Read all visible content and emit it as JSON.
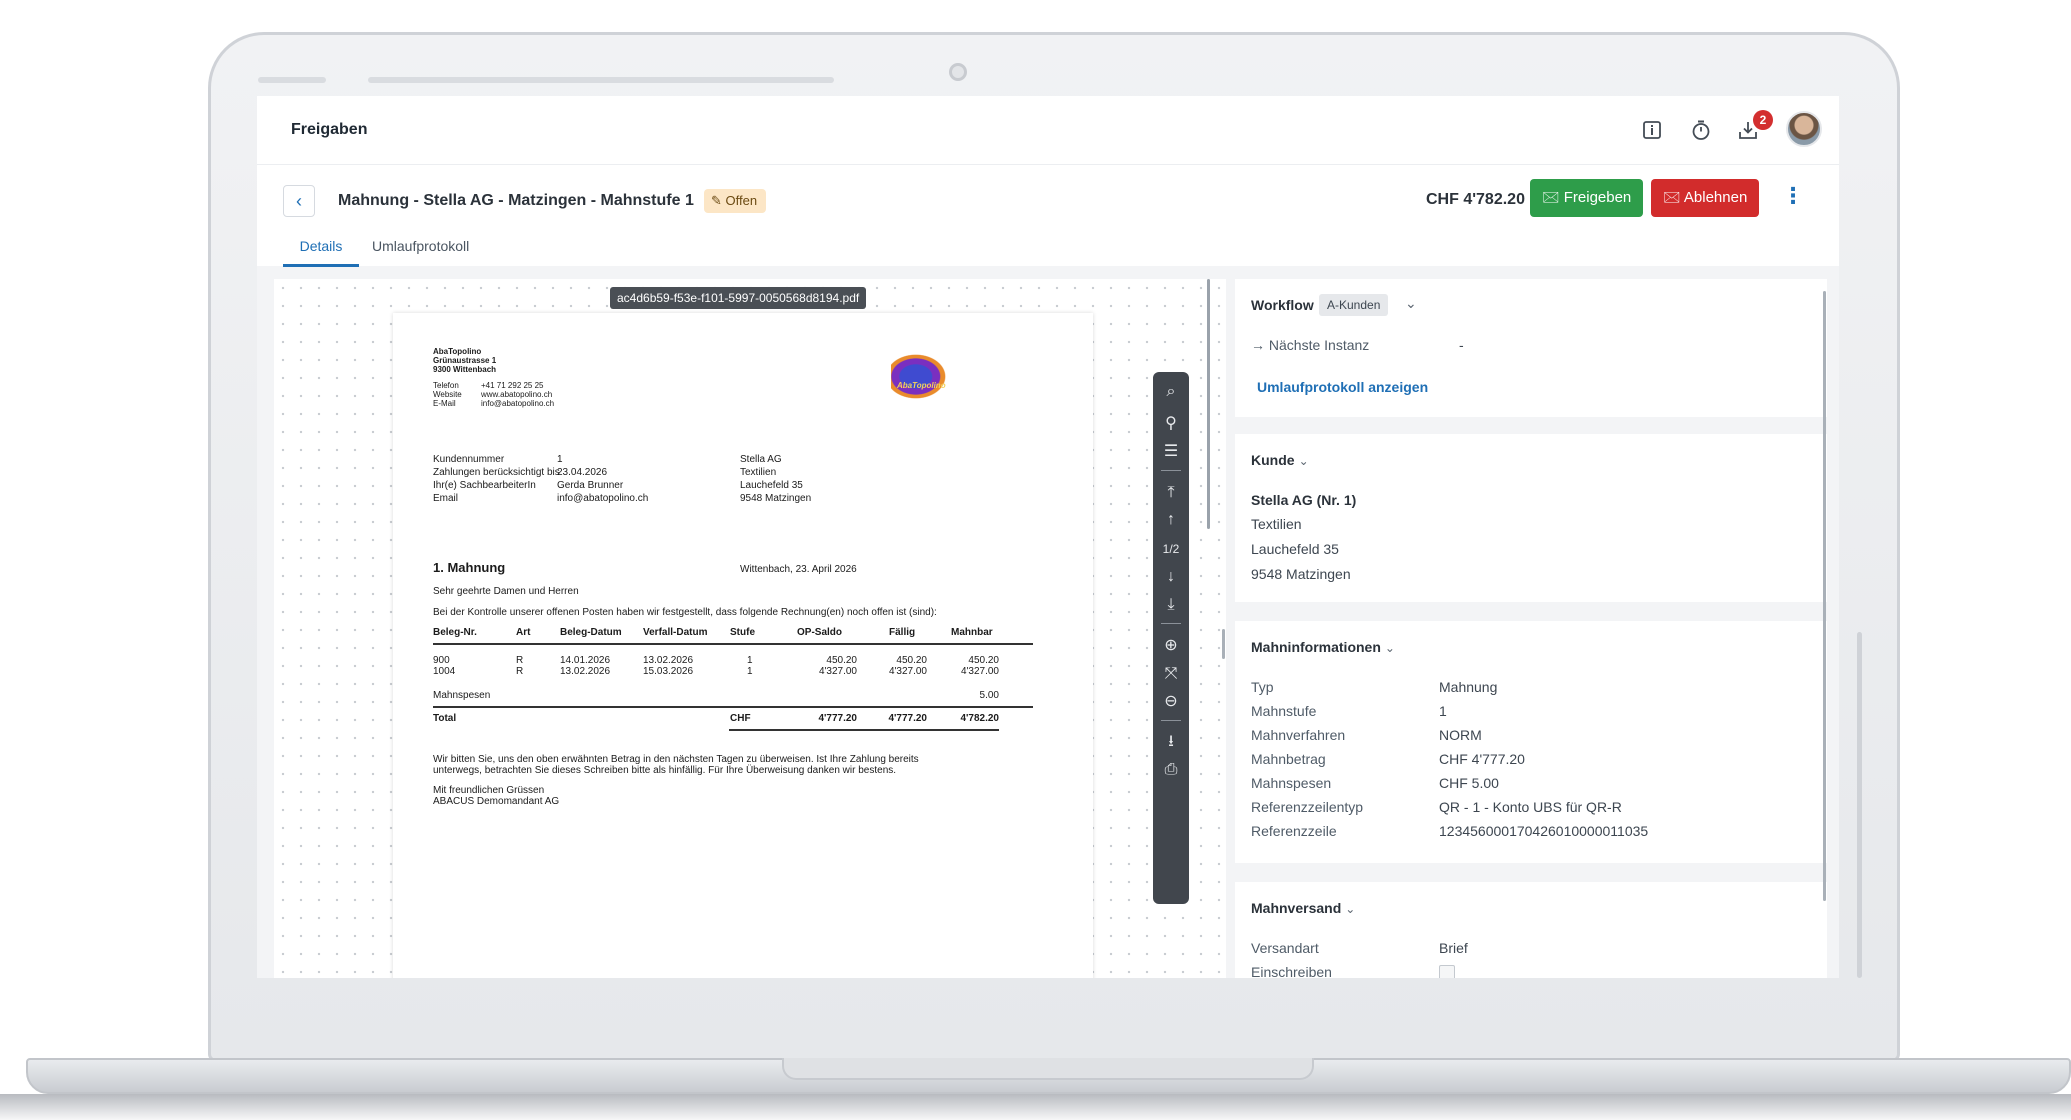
{
  "app": {
    "title": "Freigaben",
    "notification_count": "2",
    "icons": [
      "info-icon",
      "timer-icon",
      "download-inbox-icon",
      "avatar"
    ]
  },
  "header": {
    "back_icon": "‹",
    "title": "Mahnung - Stella AG - Matzingen - Mahnstufe 1",
    "status": "Offen",
    "amount": "CHF 4'782.20",
    "approve_label": "Freigeben",
    "reject_label": "Ablehnen",
    "tabs": [
      {
        "label": "Details",
        "active": true
      },
      {
        "label": "Umlaufprotokoll",
        "active": false
      }
    ]
  },
  "document": {
    "filename": "ac4d6b59-f53e-f101-5997-0050568d8194.pdf",
    "sender": {
      "name": "AbaTopolino",
      "street": "Grünaustrasse 1",
      "city": "9300 Wittenbach",
      "contacts": [
        {
          "label": "Telefon",
          "value": "+41 71 292 25 25"
        },
        {
          "label": "Website",
          "value": "www.abatopolino.ch"
        },
        {
          "label": "E-Mail",
          "value": "info@abatopolino.ch"
        }
      ],
      "logo_text": "AbaTopolino"
    },
    "meta": [
      {
        "label": "Kundennummer",
        "value": "1"
      },
      {
        "label": "Zahlungen berücksichtigt bis",
        "value": "23.04.2026"
      },
      {
        "label": "Ihr(e) SachbearbeiterIn",
        "value": "Gerda Brunner"
      },
      {
        "label": "Email",
        "value": "info@abatopolino.ch"
      }
    ],
    "recipient": [
      "Stella AG",
      "Textilien",
      "Lauchefeld 35",
      "9548 Matzingen"
    ],
    "heading": "1. Mahnung",
    "date_line": "Wittenbach, 23. April 2026",
    "salutation": "Sehr geehrte Damen und Herren",
    "intro": "Bei der Kontrolle unserer offenen Posten haben wir festgestellt, dass folgende Rechnung(en) noch offen ist (sind):",
    "table_headers": [
      "Beleg-Nr.",
      "Art",
      "Beleg-Datum",
      "Verfall-Datum",
      "Stufe",
      "OP-Saldo",
      "Fällig",
      "Mahnbar"
    ],
    "table_rows": [
      [
        "900",
        "R",
        "14.01.2026",
        "13.02.2026",
        "1",
        "450.20",
        "450.20",
        "450.20"
      ],
      [
        "1004",
        "R",
        "13.02.2026",
        "15.03.2026",
        "1",
        "4'327.00",
        "4'327.00",
        "4'327.00"
      ]
    ],
    "fees_label": "Mahnspesen",
    "fees_value": "5.00",
    "total_label": "Total",
    "total_currency": "CHF",
    "total_op": "4'777.20",
    "total_due": "4'777.20",
    "total_dunnable": "4'782.20",
    "closing_1": "Wir bitten Sie, uns den oben erwähnten Betrag in den nächsten Tagen zu überweisen. Ist Ihre Zahlung bereits",
    "closing_2": "unterwegs, betrachten Sie dieses Schreiben bitte als hinfällig. Für Ihre Überweisung danken wir bestens.",
    "greeting": "Mit freundlichen Grüssen",
    "signature": "ABACUS Demomandant AG"
  },
  "viewer_toolbar": [
    {
      "name": "search-icon",
      "glyph": "⌕"
    },
    {
      "name": "attachment-icon",
      "glyph": "⚲"
    },
    {
      "name": "outline-icon",
      "glyph": "☰"
    },
    {
      "name": "first-page-icon",
      "glyph": "⤒"
    },
    {
      "name": "previous-page-icon",
      "glyph": "↑"
    },
    {
      "name": "page-indicator",
      "glyph": "1/2"
    },
    {
      "name": "next-page-icon",
      "glyph": "↓"
    },
    {
      "name": "last-page-icon",
      "glyph": "⤓"
    },
    {
      "name": "zoom-in-icon",
      "glyph": "⊕"
    },
    {
      "name": "fit-icon",
      "glyph": "⤧"
    },
    {
      "name": "zoom-out-icon",
      "glyph": "⊖"
    },
    {
      "name": "download-icon",
      "glyph": "⭳"
    },
    {
      "name": "print-icon",
      "glyph": "⎙"
    }
  ],
  "workflow": {
    "title": "Workflow",
    "tag": "A-Kunden",
    "next_label": "Nächste Instanz",
    "next_value": "-",
    "link": "Umlaufprotokoll anzeigen"
  },
  "customer": {
    "title": "Kunde",
    "lines": [
      "Stella AG (Nr. 1)",
      "Textilien",
      "Lauchefeld 35",
      "9548 Matzingen"
    ]
  },
  "dunning_info": {
    "title": "Mahninformationen",
    "rows": [
      {
        "label": "Typ",
        "value": "Mahnung"
      },
      {
        "label": "Mahnstufe",
        "value": "1"
      },
      {
        "label": "Mahnverfahren",
        "value": "NORM"
      },
      {
        "label": "Mahnbetrag",
        "value": "CHF 4'777.20"
      },
      {
        "label": "Mahnspesen",
        "value": "CHF 5.00"
      },
      {
        "label": "Referenzzeilentyp",
        "value": "QR - 1 - Konto UBS für QR-R"
      },
      {
        "label": "Referenzzeile",
        "value": "123456000170426010000011035"
      }
    ]
  },
  "dunning_dispatch": {
    "title": "Mahnversand",
    "rows": [
      {
        "label": "Versandart",
        "value": "Brief"
      },
      {
        "label": "Einschreiben",
        "value": ""
      }
    ]
  }
}
